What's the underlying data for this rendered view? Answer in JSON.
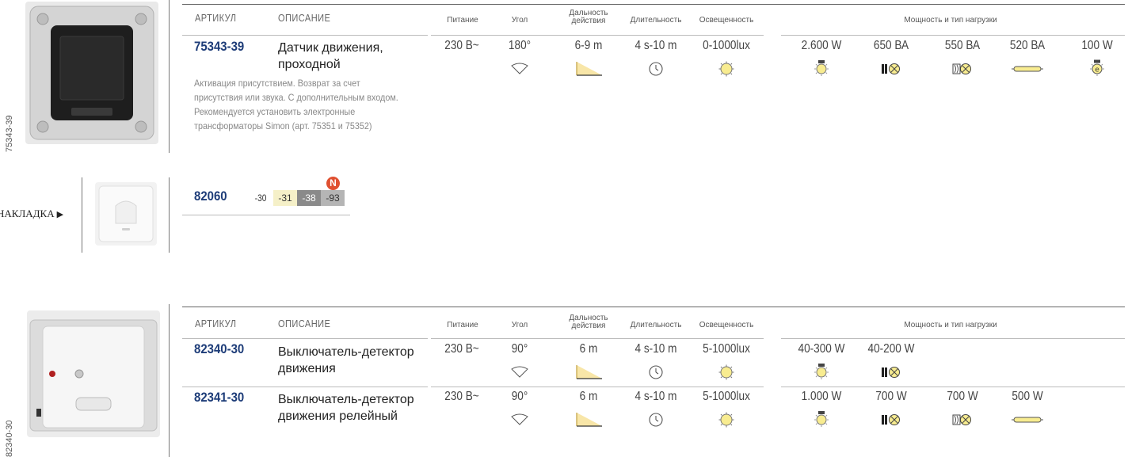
{
  "headers": {
    "article": "АРТИКУЛ",
    "description": "ОПИСАНИЕ",
    "power": "Питание",
    "angle": "Угол",
    "range": "Дальность действия",
    "duration": "Длительность",
    "light": "Освещенность",
    "load": "Мощность и тип нагрузки"
  },
  "product1": {
    "side_code": "75343-39",
    "article": "75343-39",
    "description": "Датчик движения, проходной",
    "note": "Активация присутствием. Возврат за счет присутствия или звука. С дополнительным входом. Рекомендуется установить электронные трансформаторы Simon (арт. 75351 и 75352)",
    "power": "230 В~",
    "angle": "180°",
    "range": "6-9 m",
    "duration": "4 s-10 m",
    "light": "0-1000lux",
    "loads": [
      "2.600 W",
      "650 ВА",
      "550 ВА",
      "520 ВА",
      "100 W"
    ]
  },
  "cover": {
    "label": "НАКЛАДКА",
    "article": "82060",
    "variants": [
      "-30",
      "-31",
      "-38",
      "-93"
    ],
    "new_badge": "N"
  },
  "group2": {
    "side_code": "82340-30",
    "rows": [
      {
        "article": "82340-30",
        "description": "Выключатель-детектор движения",
        "power": "230 В~",
        "angle": "90°",
        "range": "6 m",
        "duration": "4 s-10 m",
        "light": "5-1000lux",
        "loads": [
          "40-300 W",
          "40-200 W"
        ]
      },
      {
        "article": "82341-30",
        "description": "Выключатель-детектор движения релейный",
        "power": "230 В~",
        "angle": "90°",
        "range": "6 m",
        "duration": "4 s-10 m",
        "light": "5-1000lux",
        "loads": [
          "1.000 W",
          "700 W",
          "700 W",
          "500 W"
        ]
      }
    ]
  },
  "colors": {
    "article": "#1d3c78",
    "chip_cream": "#f5f0c8",
    "chip_dark": "#8a8a8a",
    "chip_mid": "#b5b5b5",
    "badge": "#e05030"
  }
}
